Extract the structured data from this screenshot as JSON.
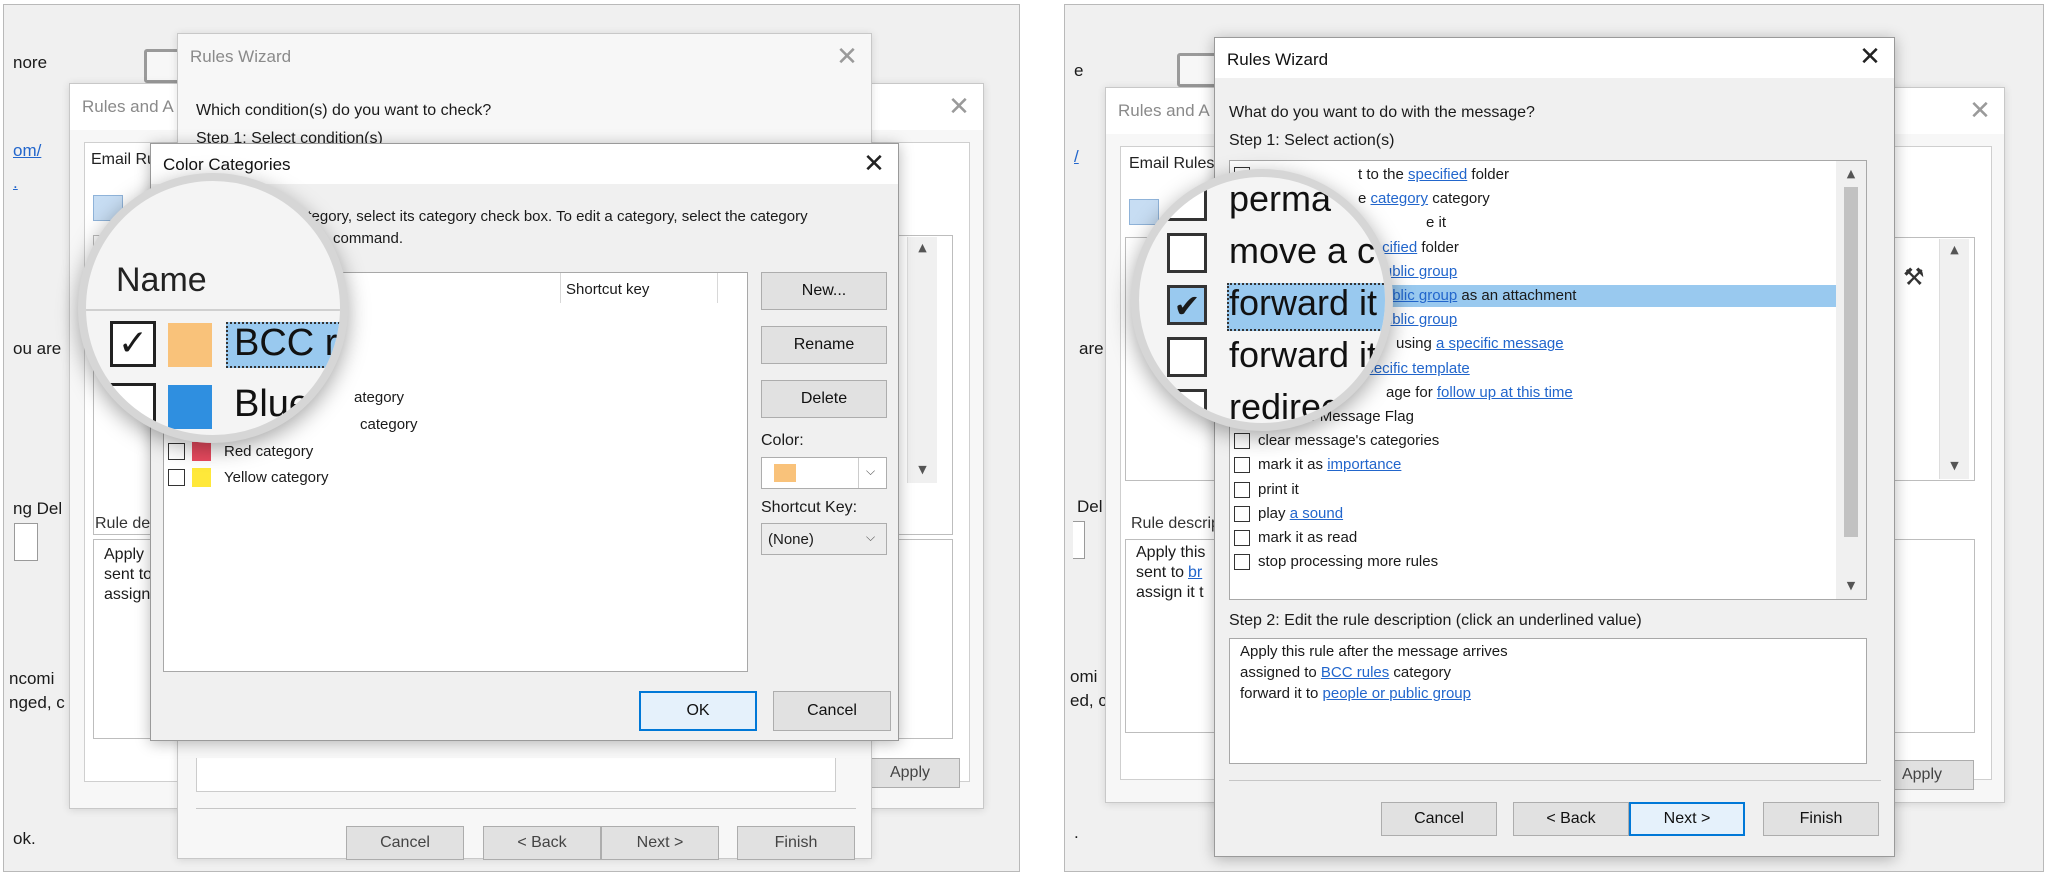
{
  "left": {
    "bg": {
      "t1": "nore",
      "t2": "om/",
      "t3": ".",
      "t4": "ou are",
      "t5": "ng Del",
      "t6": "ncomi",
      "t7": "nged, c",
      "t8": "ok.",
      "apply": "Apply"
    },
    "rules_alerts": {
      "title": "Rules and A",
      "tab": "Email Ru",
      "rule_desc_label": "Rule de",
      "desc_lines": [
        "Apply",
        "sent to",
        "assign"
      ]
    },
    "wizard": {
      "title": "Rules Wizard",
      "question": "Which condition(s) do you want to check?",
      "step1": "Step 1: Select condition(s)",
      "buttons": {
        "cancel": "Cancel",
        "back": "< Back",
        "next": "Next >",
        "finish": "Finish"
      }
    },
    "color_categories": {
      "title": "Color Categories",
      "instructions_1": "ategory, select its category check box.  To edit a category, select the category",
      "instructions_2": "command.",
      "col_shortcut": "Shortcut key",
      "rows": [
        {
          "name": "ategory",
          "color": "#1fbf6f",
          "checked": false
        },
        {
          "name": "category",
          "color": "#1fbf6f",
          "checked": false
        },
        {
          "name": "Red category",
          "color": "#e84a5f",
          "checked": false
        },
        {
          "name": "Yellow category",
          "color": "#ffe83a",
          "checked": false
        }
      ],
      "buttons": {
        "new": "New...",
        "rename": "Rename",
        "delete": "Delete",
        "ok": "OK",
        "cancel": "Cancel"
      },
      "color_label": "Color:",
      "color_value": "#f9c27a",
      "shortcut_label": "Shortcut Key:",
      "shortcut_value": "(None)"
    },
    "zoom": {
      "header": "Name",
      "rows": [
        {
          "name": "BCC ru",
          "color": "#f9c27a",
          "checked": true
        },
        {
          "name": "Blue",
          "color": "#2f8fe0",
          "checked": false
        }
      ]
    }
  },
  "right": {
    "bg": {
      "t1": "e",
      "t2": "/",
      "t3": "are",
      "t4": "Del",
      "t5": "omi",
      "t6": "ed, c",
      "t7": ".",
      "apply": "Apply"
    },
    "rules_alerts": {
      "title": "Rules and A",
      "tab": "Email Rules",
      "rule_desc_label": "Rule descrip",
      "desc_lines": [
        "Apply this",
        "sent to",
        "assign it t"
      ],
      "desc_link": "br"
    },
    "wizard": {
      "title": "Rules Wizard",
      "question": "What do you want to do with the message?",
      "step1": "Step 1: Select action(s)",
      "actions": [
        {
          "pre": "t to the ",
          "link": "specified",
          "post": " folder",
          "checked": false
        },
        {
          "pre": "e ",
          "link": "category",
          "post": " category",
          "checked": false
        },
        {
          "pre": "e it",
          "link": "",
          "post": "",
          "checked": false
        },
        {
          "pre": "",
          "link": "specified",
          "post": " folder",
          "checked": false
        },
        {
          "pre": "",
          "link": "or public group",
          "post": "",
          "checked": true
        },
        {
          "pre": "",
          "link": "or public group",
          "post": " as an attachment",
          "checked": false
        },
        {
          "pre": "",
          "link": "or public group",
          "post": "",
          "checked": false
        },
        {
          "pre": "using ",
          "link": "a specific message",
          "post": "",
          "checked": false
        },
        {
          "pre": "",
          "link": "specific template",
          "post": "",
          "checked": false
        },
        {
          "pre": "age for ",
          "link": "follow up at this time",
          "post": "",
          "checked": false
        },
        {
          "pre": "clear the Message Flag",
          "link": "",
          "post": "",
          "checked": false
        },
        {
          "pre": "clear message's categories",
          "link": "",
          "post": "",
          "checked": false
        },
        {
          "pre": "mark it as ",
          "link": "importance",
          "post": "",
          "checked": false
        },
        {
          "pre": "print it",
          "link": "",
          "post": "",
          "checked": false
        },
        {
          "pre": "play ",
          "link": "a sound",
          "post": "",
          "checked": false
        },
        {
          "pre": "mark it as read",
          "link": "",
          "post": "",
          "checked": false
        },
        {
          "pre": "stop processing more rules",
          "link": "",
          "post": "",
          "checked": false
        }
      ],
      "step2": "Step 2: Edit the rule description (click an underlined value)",
      "desc": [
        {
          "pre": "Apply this rule after the message arrives",
          "link": "",
          "post": ""
        },
        {
          "pre": "assigned to ",
          "link": "BCC rules",
          "post": " category"
        },
        {
          "pre": "forward it to ",
          "link": "people or public group",
          "post": ""
        }
      ],
      "buttons": {
        "cancel": "Cancel",
        "back": "< Back",
        "next": "Next >",
        "finish": "Finish"
      }
    },
    "zoom": {
      "rows": [
        {
          "name": "perma",
          "checked": false
        },
        {
          "name": "move a c",
          "checked": false
        },
        {
          "name": "forward it",
          "checked": true
        },
        {
          "name": "forward it",
          "checked": false
        },
        {
          "name": "redirect",
          "checked": false
        }
      ]
    }
  }
}
